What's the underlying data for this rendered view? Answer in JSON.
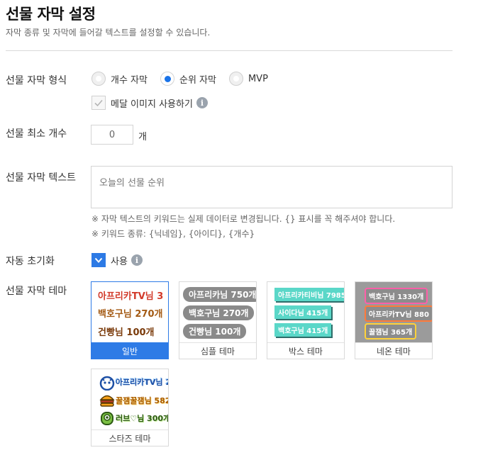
{
  "header": {
    "title": "선물 자막 설정",
    "subtitle": "자막 종류 및 자막에 들어갈 텍스트를 설정할 수 있습니다."
  },
  "format": {
    "label": "선물 자막 형식",
    "options": [
      "개수 자막",
      "순위 자막",
      "MVP"
    ],
    "selected": "순위 자막",
    "medal_label": "메달 이미지 사용하기",
    "medal_checked": true,
    "info_glyph": "i"
  },
  "min_count": {
    "label": "선물 최소 개수",
    "value": "0",
    "unit": "개"
  },
  "text": {
    "label": "선물 자막 텍스트",
    "placeholder": "오늘의 선물 순위",
    "notes": [
      "※ 자막 텍스트의 키워드는 실제 데이터로 변경됩니다. {} 표시를 꼭 해주셔야 합니다.",
      "※ 키워드 종류: {닉네임}, {아이디}, {개수}"
    ]
  },
  "reset": {
    "label": "자동 초기화",
    "option_label": "사용",
    "checked": true
  },
  "theme": {
    "label": "선물 자막 테마",
    "selected": "일반",
    "items": [
      {
        "caption": "일반",
        "lines": [
          "아프리카TV님 3",
          "백호구님 270개",
          "건빵님 100개"
        ]
      },
      {
        "caption": "심플 테마",
        "lines": [
          "아프리카님 750개",
          "백호구님 270개",
          "건빵님 100개"
        ]
      },
      {
        "caption": "박스 테마",
        "lines": [
          "아프리카티비님 7985",
          "사이다님 415개",
          "백호구님 415개"
        ]
      },
      {
        "caption": "네온 테마",
        "lines": [
          "백호구님 1330개",
          "아프리카TV님 880",
          "꿀잼님 365개"
        ]
      },
      {
        "caption": "스타즈 테마",
        "lines": [
          "아프리카TV님 2",
          "꿀잼꿀잼님 582",
          "러브♡님 300개"
        ]
      }
    ]
  },
  "colors": {
    "accent": "#2e7be6",
    "radio_selected": "#1a73e8"
  }
}
